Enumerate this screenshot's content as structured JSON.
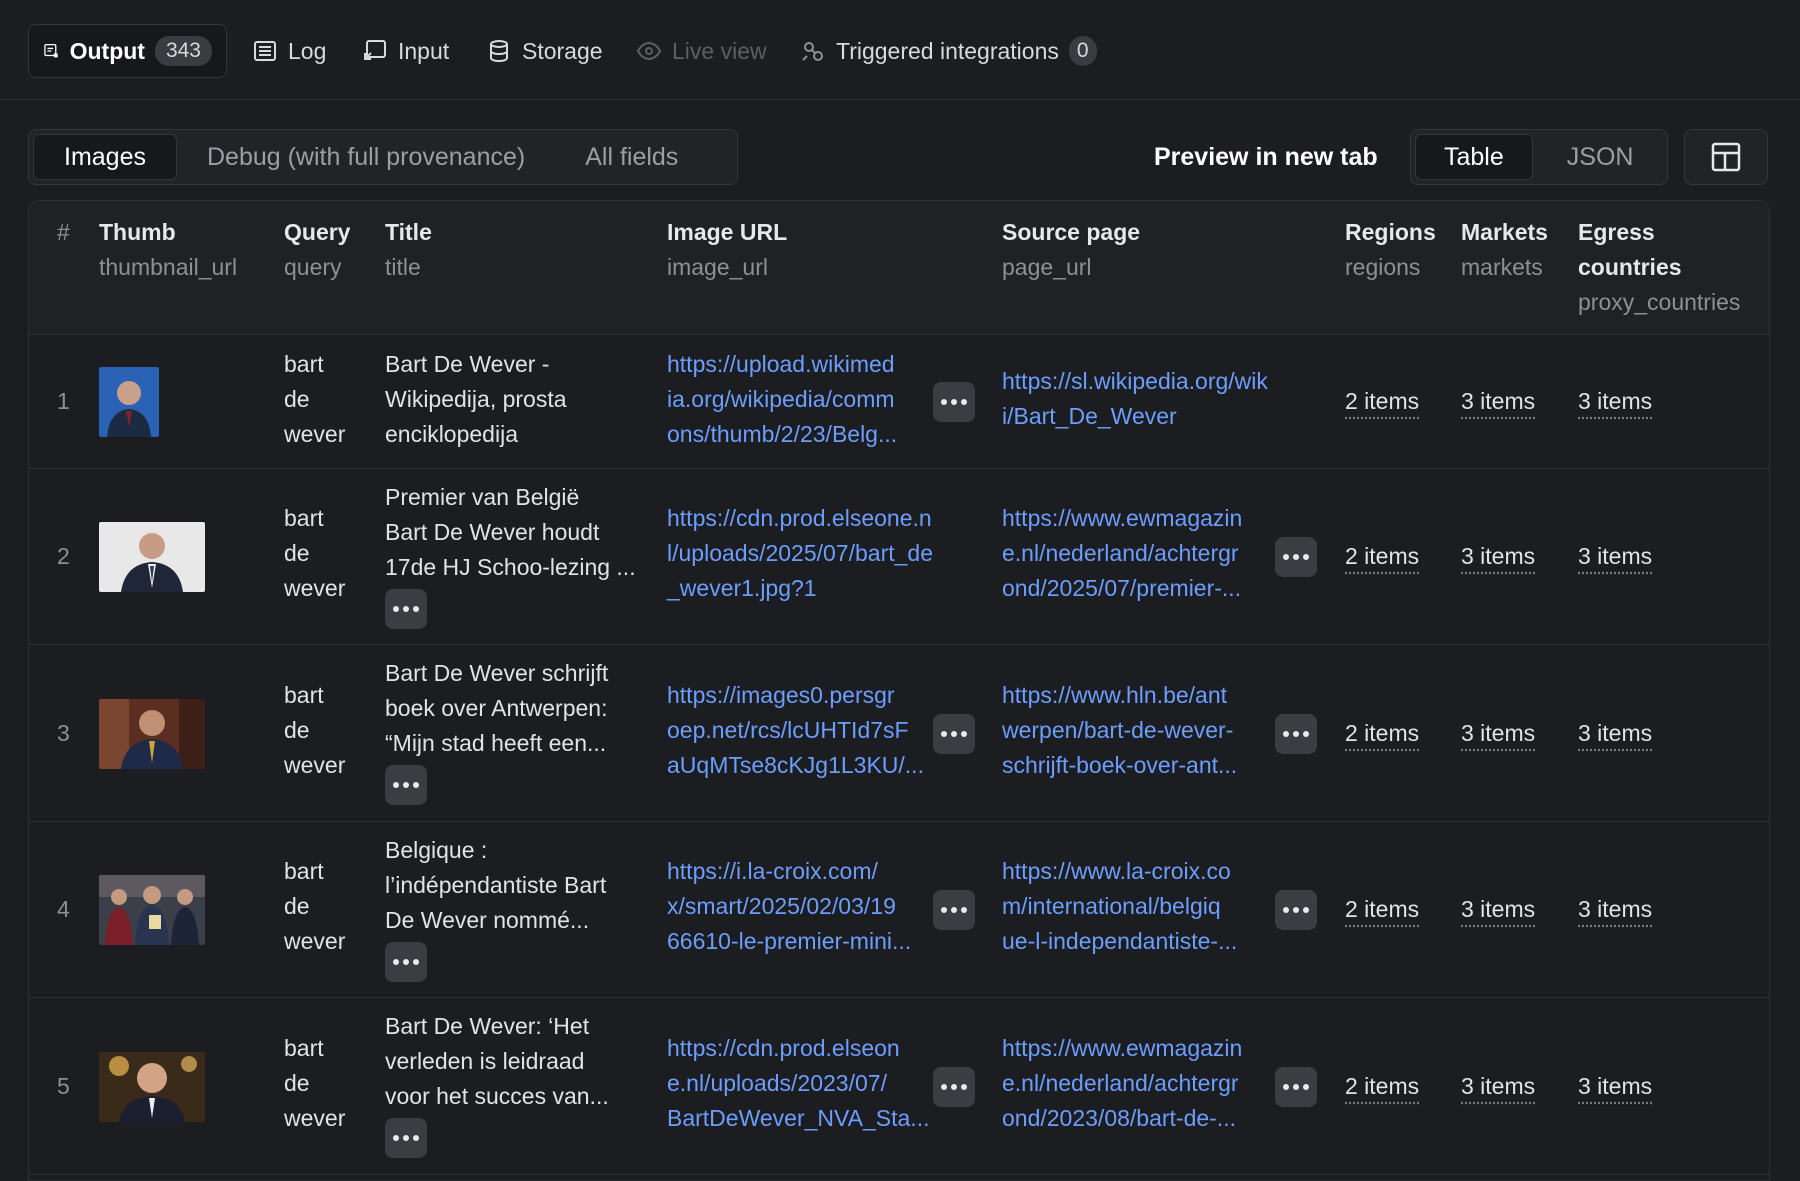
{
  "tabs": {
    "output_label": "Output",
    "output_count": "343",
    "log_label": "Log",
    "input_label": "Input",
    "storage_label": "Storage",
    "live_view_label": "Live view",
    "triggered_label": "Triggered integrations",
    "triggered_count": "0"
  },
  "view_tabs": {
    "images": "Images",
    "debug": "Debug (with full provenance)",
    "all_fields": "All fields"
  },
  "preview_label": "Preview in new tab",
  "format_toggle": {
    "table": "Table",
    "json": "JSON"
  },
  "columns": {
    "num": "#",
    "thumb": {
      "name": "Thumb",
      "key": "thumbnail_url"
    },
    "query": {
      "name": "Query",
      "key": "query"
    },
    "title": {
      "name": "Title",
      "key": "title"
    },
    "image_url": {
      "name": "Image URL",
      "key": "image_url"
    },
    "source_page": {
      "name": "Source page",
      "key": "page_url"
    },
    "regions": {
      "name": "Regions",
      "key": "regions"
    },
    "markets": {
      "name": "Markets",
      "key": "markets"
    },
    "egress": {
      "name_line1": "Egress",
      "name_line2": "countries",
      "key": "proxy_countries"
    }
  },
  "rows": [
    {
      "num": "1",
      "query": [
        "bart",
        "de",
        "wever"
      ],
      "title": [
        "Bart De Wever -",
        "Wikipedija, prosta",
        "enciklopedija"
      ],
      "image_url": [
        "https://upload.wikimed",
        "ia.org/wikipedia/comm",
        "ons/thumb/2/23/Belg..."
      ],
      "page_url": [
        "https://sl.wikipedia.org/wik",
        "i/Bart_De_Wever"
      ],
      "regions": "2 items",
      "markets": "3 items",
      "egress": "3 items"
    },
    {
      "num": "2",
      "query": [
        "bart",
        "de",
        "wever"
      ],
      "title": [
        "Premier van België",
        "Bart De Wever houdt",
        "17de HJ Schoo-lezing ..."
      ],
      "image_url": [
        "https://cdn.prod.elseone.n",
        "l/uploads/2025/07/bart_de",
        "_wever1.jpg?1"
      ],
      "page_url": [
        "https://www.ewmagazin",
        "e.nl/nederland/achtergr",
        "ond/2025/07/premier-..."
      ],
      "regions": "2 items",
      "markets": "3 items",
      "egress": "3 items"
    },
    {
      "num": "3",
      "query": [
        "bart",
        "de",
        "wever"
      ],
      "title": [
        "Bart De Wever schrijft",
        "boek over Antwerpen:",
        "“Mijn stad heeft een..."
      ],
      "image_url": [
        "https://images0.persgr",
        "oep.net/rcs/lcUHTId7sF",
        "aUqMTse8cKJg1L3KU/..."
      ],
      "page_url": [
        "https://www.hln.be/ant",
        "werpen/bart-de-wever-",
        "schrijft-boek-over-ant..."
      ],
      "regions": "2 items",
      "markets": "3 items",
      "egress": "3 items"
    },
    {
      "num": "4",
      "query": [
        "bart",
        "de",
        "wever"
      ],
      "title": [
        "Belgique :",
        "l’indépendantiste Bart",
        "De Wever nommé..."
      ],
      "image_url": [
        "https://i.la-croix.com/",
        "x/smart/2025/02/03/19",
        "66610-le-premier-mini..."
      ],
      "page_url": [
        "https://www.la-croix.co",
        "m/international/belgiq",
        "ue-l-independantiste-..."
      ],
      "regions": "2 items",
      "markets": "3 items",
      "egress": "3 items"
    },
    {
      "num": "5",
      "query": [
        "bart",
        "de",
        "wever"
      ],
      "title": [
        "Bart De Wever: ‘Het",
        "verleden is leidraad",
        "voor het succes van..."
      ],
      "image_url": [
        "https://cdn.prod.elseon",
        "e.nl/uploads/2023/07/",
        "BartDeWever_NVA_Sta..."
      ],
      "page_url": [
        "https://www.ewmagazin",
        "e.nl/nederland/achtergr",
        "ond/2023/08/bart-de-..."
      ],
      "regions": "2 items",
      "markets": "3 items",
      "egress": "3 items"
    }
  ],
  "colors": {
    "background": "#1c1d20",
    "link": "#6c9eff",
    "muted": "#8d9096"
  }
}
